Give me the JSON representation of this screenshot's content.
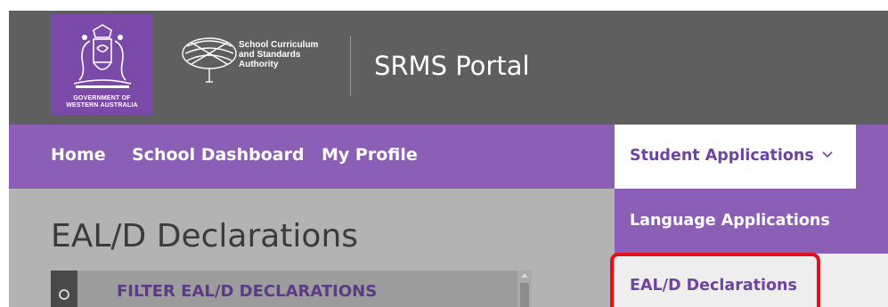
{
  "header": {
    "crest_caption": "GOVERNMENT OF\nWESTERN AUSTRALIA",
    "scsa_text": "School Curriculum\nand Standards\nAuthority",
    "portal_title": "SRMS Portal"
  },
  "nav": {
    "items": [
      {
        "label": "Home"
      },
      {
        "label": "School Dashboard"
      },
      {
        "label": "My Profile"
      }
    ],
    "dropdown_label": "Student Applications",
    "dropdown_icon": "chevron-down-icon"
  },
  "menu": {
    "items": [
      {
        "label": "Language Applications"
      },
      {
        "label": "EAL/D Declarations",
        "highlighted": true
      }
    ]
  },
  "main": {
    "page_title": "EAL/D Declarations",
    "filter_label": "FILTER EAL/D DECLARATIONS"
  },
  "colors": {
    "header_bg": "#5f5f5f",
    "nav_bg": "#8a5fb5",
    "crest_bg": "#7b4aa8",
    "highlight": "#e3101c",
    "content_overlay": "#b3b3b3"
  }
}
